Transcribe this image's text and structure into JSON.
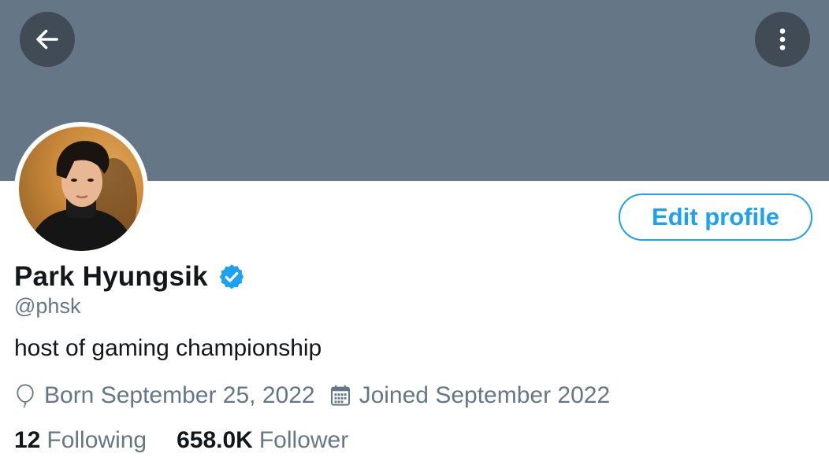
{
  "header": {
    "back_icon": "arrow-left-icon",
    "more_icon": "more-vertical-icon",
    "banner_color": "#657786"
  },
  "profile": {
    "display_name": "Park Hyungsik",
    "verified": true,
    "verified_icon": "verified-badge-icon",
    "handle": "@phsk",
    "bio": "host of gaming championship",
    "birth": "Born September 25, 2022",
    "joined": "Joined September 2022",
    "edit_profile_label": "Edit profile"
  },
  "stats": {
    "following_count": "12",
    "following_label": "Following",
    "followers_count": "658.0K",
    "followers_label": "Follower"
  },
  "colors": {
    "accent": "#1da1f2",
    "text_primary": "#14171a",
    "text_secondary": "#657786"
  }
}
